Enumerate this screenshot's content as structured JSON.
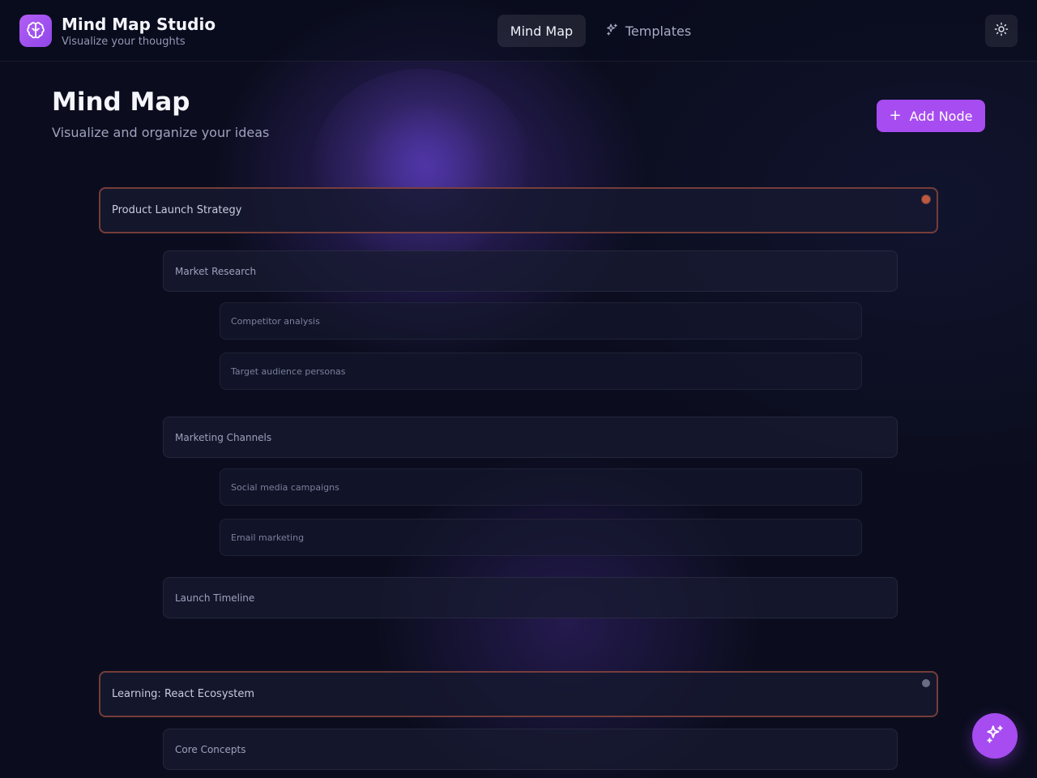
{
  "header": {
    "app_title": "Mind Map Studio",
    "app_subtitle": "Visualize your thoughts",
    "logo_icon": "brain-icon",
    "tabs": [
      {
        "label": "Mind Map",
        "active": true,
        "icon": ""
      },
      {
        "label": "Templates",
        "active": false,
        "icon": "sparkles-icon"
      }
    ],
    "theme_toggle_icon": "sun-icon"
  },
  "page": {
    "title": "Mind Map",
    "subtitle": "Visualize and organize your ideas",
    "add_button_label": "Add Node",
    "add_button_icon": "plus-icon"
  },
  "mindmaps": [
    {
      "label": "Product Launch Strategy",
      "status_color": "#c0583e",
      "children": [
        {
          "label": "Market Research",
          "children": [
            {
              "label": "Competitor analysis"
            },
            {
              "label": "Target audience personas"
            }
          ]
        },
        {
          "label": "Marketing Channels",
          "children": [
            {
              "label": "Social media campaigns"
            },
            {
              "label": "Email marketing"
            }
          ]
        },
        {
          "label": "Launch Timeline",
          "children": []
        }
      ]
    },
    {
      "label": "Learning: React Ecosystem",
      "status_color": "#6a6c84",
      "children": [
        {
          "label": "Core Concepts",
          "children": []
        }
      ]
    }
  ],
  "fab_icon": "sparkles-icon",
  "colors": {
    "accent": "#a64cf0",
    "background": "#0b0d1e",
    "root_border": "#c45c46"
  }
}
